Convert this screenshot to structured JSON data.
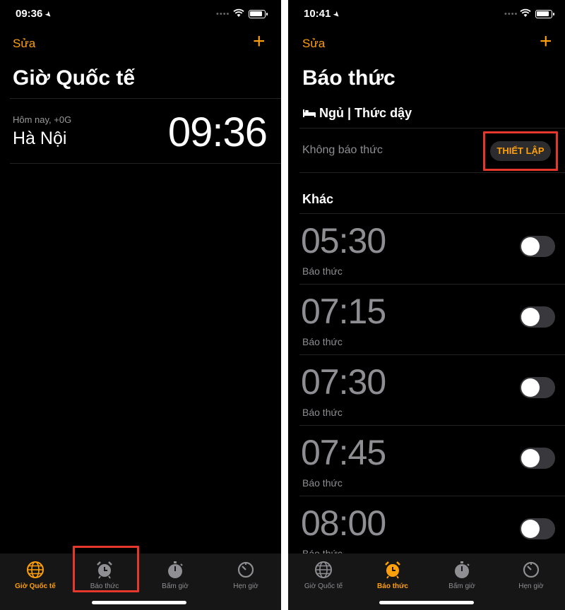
{
  "colors": {
    "accent": "#ff9f0a",
    "highlight": "#e5372c",
    "inactive": "#8e8e93",
    "background": "#000000"
  },
  "left": {
    "status_time": "09:36",
    "nav": {
      "edit_label": "Sửa",
      "add_label": "+"
    },
    "title": "Giờ Quốc tế",
    "clock": {
      "subtitle": "Hôm nay, +0G",
      "city": "Hà Nội",
      "time": "09:36"
    },
    "tabs": [
      {
        "label": "Giờ Quốc tế",
        "icon": "globe-icon",
        "active": true
      },
      {
        "label": "Báo thức",
        "icon": "alarm-clock-icon",
        "active": false,
        "highlighted": true
      },
      {
        "label": "Bấm giờ",
        "icon": "stopwatch-icon",
        "active": false
      },
      {
        "label": "Hẹn giờ",
        "icon": "timer-icon",
        "active": false
      }
    ]
  },
  "right": {
    "status_time": "10:41",
    "nav": {
      "edit_label": "Sửa",
      "add_label": "+"
    },
    "title": "Báo thức",
    "sleep": {
      "icon": "bed-icon",
      "title": "Ngủ | Thức dậy",
      "no_alarm_text": "Không báo thức",
      "setup_label": "THIẾT LẬP"
    },
    "section_title": "Khác",
    "alarms": [
      {
        "time": "05:30",
        "label": "Báo thức",
        "enabled": false
      },
      {
        "time": "07:15",
        "label": "Báo thức",
        "enabled": false
      },
      {
        "time": "07:30",
        "label": "Báo thức",
        "enabled": false
      },
      {
        "time": "07:45",
        "label": "Báo thức",
        "enabled": false
      },
      {
        "time": "08:00",
        "label": "Báo thức",
        "enabled": false
      }
    ],
    "tabs": [
      {
        "label": "Giờ Quốc tế",
        "icon": "globe-icon",
        "active": false
      },
      {
        "label": "Báo thức",
        "icon": "alarm-clock-icon",
        "active": true
      },
      {
        "label": "Bấm giờ",
        "icon": "stopwatch-icon",
        "active": false
      },
      {
        "label": "Hẹn giờ",
        "icon": "timer-icon",
        "active": false
      }
    ]
  }
}
